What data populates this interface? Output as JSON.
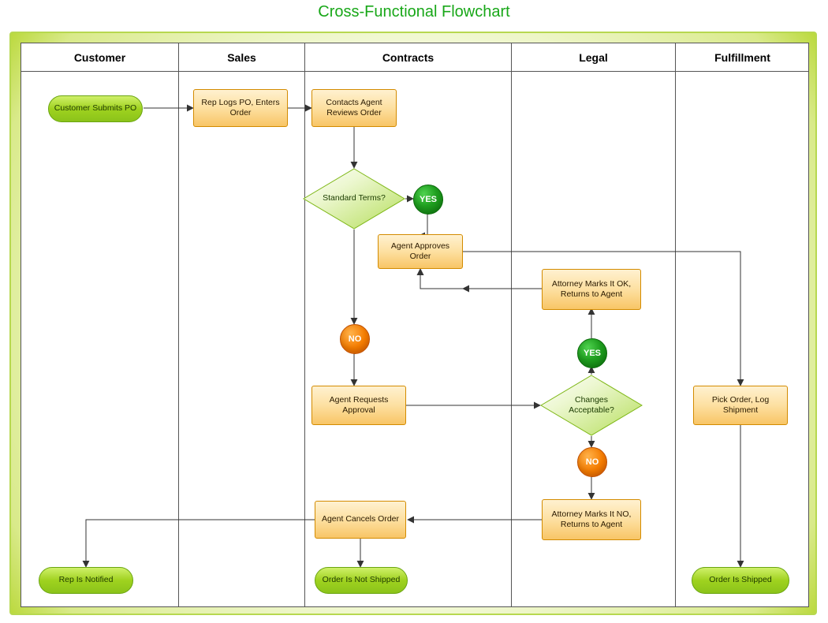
{
  "title": "Cross-Functional Flowchart",
  "lanes": {
    "customer": "Customer",
    "sales": "Sales",
    "contracts": "Contracts",
    "legal": "Legal",
    "fulfillment": "Fulfillment"
  },
  "nodes": {
    "customer_submits_po": "Customer Submits PO",
    "rep_logs_po": "Rep Logs PO, Enters Order",
    "contacts_agent_reviews": "Contacts Agent Reviews Order",
    "standard_terms": "Standard Terms?",
    "agent_approves_order": "Agent Approves Order",
    "agent_requests_approval": "Agent Requests Approval",
    "agent_cancels_order": "Agent Cancels Order",
    "attorney_ok": "Attorney Marks It OK, Returns to Agent",
    "attorney_no": "Attorney Marks It NO, Returns to Agent",
    "changes_acceptable": "Changes Acceptable?",
    "pick_order": "Pick Order, Log Shipment",
    "rep_is_notified": "Rep Is Notified",
    "order_not_shipped": "Order Is Not Shipped",
    "order_shipped": "Order Is Shipped"
  },
  "labels": {
    "yes": "YES",
    "no": "NO"
  },
  "edges": [
    [
      "customer_submits_po",
      "rep_logs_po"
    ],
    [
      "rep_logs_po",
      "contacts_agent_reviews"
    ],
    [
      "contacts_agent_reviews",
      "standard_terms"
    ],
    [
      "standard_terms",
      "YES",
      "agent_approves_order"
    ],
    [
      "standard_terms",
      "NO",
      "agent_requests_approval"
    ],
    [
      "agent_approves_order",
      "pick_order"
    ],
    [
      "agent_requests_approval",
      "changes_acceptable"
    ],
    [
      "changes_acceptable",
      "YES",
      "attorney_ok"
    ],
    [
      "changes_acceptable",
      "NO",
      "attorney_no"
    ],
    [
      "attorney_ok",
      "agent_approves_order"
    ],
    [
      "attorney_no",
      "agent_cancels_order"
    ],
    [
      "agent_cancels_order",
      "order_not_shipped"
    ],
    [
      "agent_cancels_order",
      "rep_is_notified"
    ],
    [
      "pick_order",
      "order_shipped"
    ]
  ]
}
